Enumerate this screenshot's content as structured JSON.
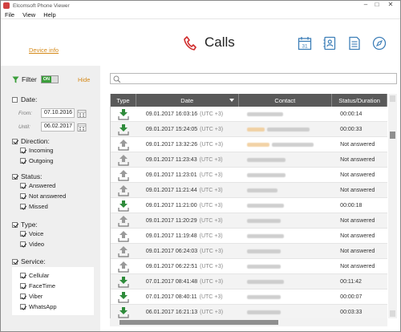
{
  "window": {
    "title": "Elcomsoft Phone Viewer",
    "controls": [
      "–",
      "□",
      "✕"
    ]
  },
  "menu": [
    "File",
    "View",
    "Help"
  ],
  "header": {
    "device_info": "Device info",
    "title": "Calls",
    "accent": "#d02b2b"
  },
  "filter": {
    "label": "Filter",
    "toggle": "ON",
    "hide": "Hide",
    "date": {
      "label": "Date:",
      "from_label": "From:",
      "from": "07.10.2016",
      "until_label": "Until:",
      "until": "06.02.2017"
    },
    "direction": {
      "label": "Direction:",
      "options": [
        "Incoming",
        "Outgoing"
      ]
    },
    "status": {
      "label": "Status:",
      "options": [
        "Answered",
        "Not answered",
        "Missed"
      ]
    },
    "type": {
      "label": "Type:",
      "options": [
        "Voice",
        "Video"
      ]
    },
    "service": {
      "label": "Service:",
      "options": [
        "Cellular",
        "FaceTime",
        "Viber",
        "WhatsApp"
      ]
    }
  },
  "table": {
    "columns": [
      "Type",
      "Date",
      "Contact",
      "Status/Duration"
    ],
    "rows": [
      {
        "dir": "in",
        "date": "09.01.2017 16:03:16",
        "tz": "(UTC +3)",
        "status": "00:00:14"
      },
      {
        "dir": "in",
        "date": "09.01.2017 15:24:05",
        "tz": "(UTC +3)",
        "status": "00:00:33"
      },
      {
        "dir": "out",
        "date": "09.01.2017 13:32:26",
        "tz": "(UTC +3)",
        "status": "Not answered"
      },
      {
        "dir": "out",
        "date": "09.01.2017 11:23:43",
        "tz": "(UTC +3)",
        "status": "Not answered"
      },
      {
        "dir": "out",
        "date": "09.01.2017 11:23:01",
        "tz": "(UTC +3)",
        "status": "Not answered"
      },
      {
        "dir": "out",
        "date": "09.01.2017 11:21:44",
        "tz": "(UTC +3)",
        "status": "Not answered"
      },
      {
        "dir": "in",
        "date": "09.01.2017 11:21:00",
        "tz": "(UTC +3)",
        "status": "00:00:18"
      },
      {
        "dir": "out",
        "date": "09.01.2017 11:20:29",
        "tz": "(UTC +3)",
        "status": "Not answered"
      },
      {
        "dir": "out",
        "date": "09.01.2017 11:19:48",
        "tz": "(UTC +3)",
        "status": "Not answered"
      },
      {
        "dir": "out",
        "date": "09.01.2017 06:24:03",
        "tz": "(UTC +3)",
        "status": "Not answered"
      },
      {
        "dir": "out",
        "date": "09.01.2017 06:22:51",
        "tz": "(UTC +3)",
        "status": "Not answered"
      },
      {
        "dir": "in",
        "date": "07.01.2017 08:41:48",
        "tz": "(UTC +3)",
        "status": "00:11:42"
      },
      {
        "dir": "in",
        "date": "07.01.2017 08:40:11",
        "tz": "(UTC +3)",
        "status": "00:00:07"
      },
      {
        "dir": "in",
        "date": "06.01.2017 16:21:13",
        "tz": "(UTC +3)",
        "status": "00:03:33"
      }
    ]
  },
  "colors": {
    "incoming": "#2e8b3a",
    "outgoing": "#9a9a9a",
    "link": "#d58a1a",
    "header_bg": "#595959"
  }
}
